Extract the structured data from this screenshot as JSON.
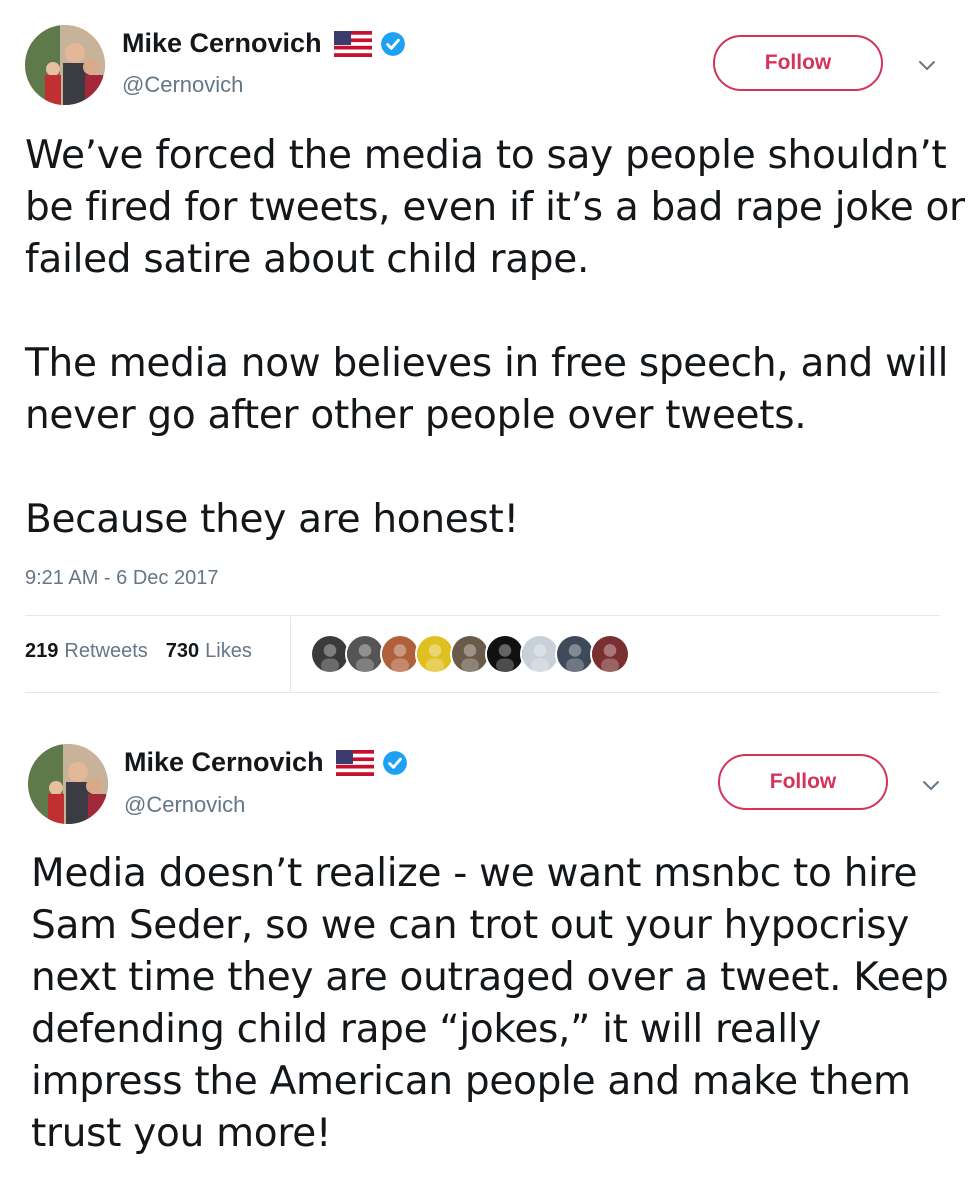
{
  "tweets": [
    {
      "author": {
        "name": "Mike Cernovich",
        "handle": "@Cernovich"
      },
      "follow_label": "Follow",
      "paragraphs": [
        "We’ve forced the media to say people shouldn’t be fired for tweets, even if it’s a bad rape joke or failed satire about child rape.",
        "The media now believes in free speech, and will never go after other people over tweets.",
        "Because they are honest!"
      ],
      "timestamp": "9:21 AM - 6 Dec 2017",
      "stats": {
        "retweets_count": "219",
        "retweets_label": "Retweets",
        "likes_count": "730",
        "likes_label": "Likes"
      },
      "liker_avatar_colors": [
        "#3a3a3a",
        "#555555",
        "#b0603a",
        "#e0c020",
        "#6a5a4a",
        "#111111",
        "#c8d0d8",
        "#3e4a5a",
        "#7a3030"
      ]
    },
    {
      "author": {
        "name": "Mike Cernovich",
        "handle": "@Cernovich"
      },
      "follow_label": "Follow",
      "paragraphs": [
        "Media doesn’t realize - we want msnbc to hire Sam Seder, so we can trot out your hypocrisy next time they are outraged over a tweet. Keep defending child rape “jokes,” it will really impress the American people and make them trust you more!"
      ]
    }
  ],
  "colors": {
    "accent": "#d4335a",
    "verified": "#1da1f2",
    "secondary_text": "#657786",
    "divider": "#e1e8ed"
  }
}
